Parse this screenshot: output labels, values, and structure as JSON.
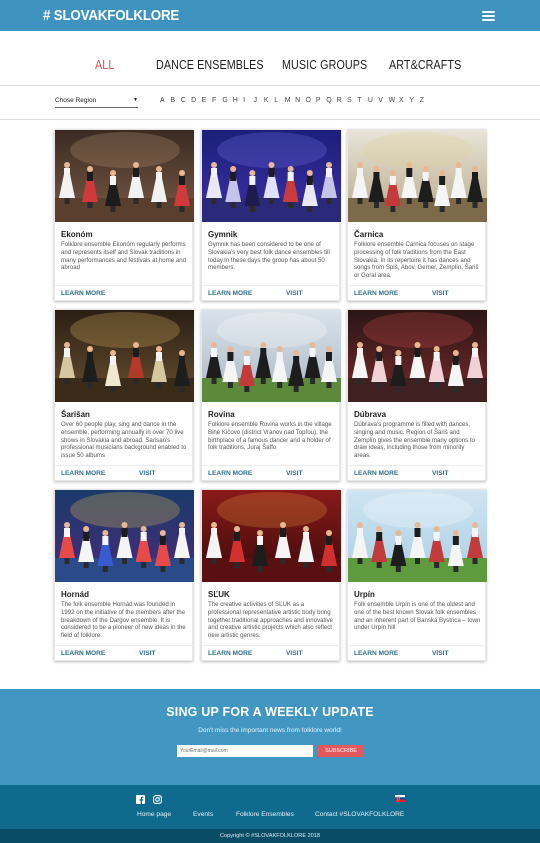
{
  "header": {
    "logo": "# SLOVAKFOLKLORE",
    "menu_icon": "hamburger-menu-icon"
  },
  "tabs": [
    "ALL",
    "DANCE ENSEMBLES",
    "MUSIC GROUPS",
    "ART&CRAFTS"
  ],
  "filter": {
    "region": "Chose Region",
    "letters": [
      "A",
      "B",
      "C",
      "D",
      "E",
      "F",
      "G",
      "H",
      "I",
      "J",
      "K",
      "L",
      "M",
      "N",
      "O",
      "P",
      "Q",
      "R",
      "S",
      "T",
      "U",
      "V",
      "W",
      "X",
      "Y",
      "Z"
    ]
  },
  "cards": [
    {
      "title": "Ekonóm",
      "desc": "Folklore ensemble Ekonóm regularly performs and represents itself and Slovak traditions in many performances and festivals at home and abroad",
      "more": "LEARN MORE",
      "visit": ""
    },
    {
      "title": "Gymnik",
      "desc": "Gymnik has been considered to be one of Slovakia’s very best folk dance ensembles till today.In these days the group has about 50 members.",
      "more": "LEARN MORE",
      "visit": "VISIT"
    },
    {
      "title": "Čarnica",
      "desc": "Folklore ensemble Čarnica focuses on stage processing of folk traditions from the East Slovakia. In its repertoire it has dances and songs from Spiš, Abov, Gemer, Zemplín, Šariš or Goral area.",
      "more": "LEARN MORE",
      "visit": "VISIT"
    },
    {
      "title": "Šarišan",
      "desc": "Over 60 people play, sing and dance in the ensemble, performing annually in over 70 live shows in Slovakia and abroad. Sarisan's professional musicians background enabled to issue 50 albums",
      "more": "LEARN MORE",
      "visit": "VISIT"
    },
    {
      "title": "Rovina",
      "desc": "Folklore ensemble Rovina works in the village Bihé Kičovo (district Vranov nad Topľou), the birthplace of a famous dancer and a holder of folk traditions, Juraj Šaffo",
      "more": "LEARN MORE",
      "visit": "VISIT"
    },
    {
      "title": "Dúbrava",
      "desc": "Dúbrava’s programme is filled with dances, singing and music. Region of Šariš and Zemplín gives the ensemble many options to draw ideas, including those from minority areas.",
      "more": "LEARN MORE",
      "visit": "VISIT"
    },
    {
      "title": "Hornád",
      "desc": "The folk ensemble Hornád was founded in 1992 on the initiative of the members after the breakdown of the Dargov ensemble. It is considered to be a pioneer of new ideas in the field of folklore.",
      "more": "LEARN MORE",
      "visit": "VISIT"
    },
    {
      "title": "SĽUK",
      "desc": "The creative activities of SĽUK as a professional representative artistic body bring together traditional approaches and innovative and creative artistic projects which also reflect new artistic genres.",
      "more": "LEARN MORE",
      "visit": "VISIT"
    },
    {
      "title": "Urpín",
      "desc": "Folk ensemble Urpín is one of the oldest and one of the best known Slovak folk ensembles and an inherent part of Banská Bystrica – town under Urpín hill",
      "more": "LEARN MORE",
      "visit": "VISIT"
    }
  ],
  "signup": {
    "heading": "SING UP FOR A WEEKLY UPDATE",
    "subtext": "Don't miss the important news from folklore world!",
    "placeholder": "YourEmail@mail.com",
    "button": "SUBSCRIBE"
  },
  "footer": {
    "links": [
      "Home page",
      "Events",
      "Folklore Ensembles",
      "Contact #SLOVAKFOLKLORE"
    ],
    "icons": [
      "facebook-icon",
      "instagram-icon",
      "slovak-flag-icon"
    ],
    "copyright": "Copyright © #SLOVAKFOLKLORE 2018"
  },
  "colors": {
    "header": "#3f93bf",
    "active_tab": "#e04f4f",
    "link": "#2f6f8f",
    "signup_bg": "#4197c2",
    "footer_bg": "#0f6a8d",
    "copyright_bg": "#0a4b66",
    "subscribe": "#e2585d"
  }
}
